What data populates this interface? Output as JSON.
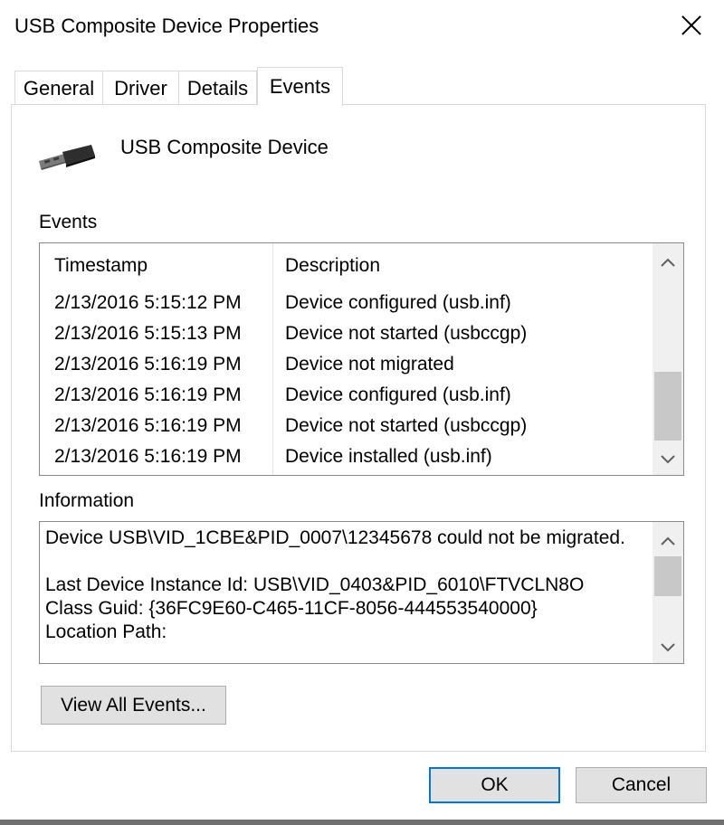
{
  "window": {
    "title": "USB Composite Device Properties"
  },
  "tabs": [
    {
      "label": "General"
    },
    {
      "label": "Driver"
    },
    {
      "label": "Details"
    },
    {
      "label": "Events"
    }
  ],
  "device": {
    "name": "USB Composite Device",
    "icon": "usb-plug-icon"
  },
  "events": {
    "label": "Events",
    "columns": {
      "timestamp": "Timestamp",
      "description": "Description"
    },
    "rows": [
      {
        "timestamp": "2/13/2016 5:15:12 PM",
        "description": "Device configured (usb.inf)"
      },
      {
        "timestamp": "2/13/2016 5:15:13 PM",
        "description": "Device not started (usbccgp)"
      },
      {
        "timestamp": "2/13/2016 5:16:19 PM",
        "description": "Device not migrated"
      },
      {
        "timestamp": "2/13/2016 5:16:19 PM",
        "description": "Device configured (usb.inf)"
      },
      {
        "timestamp": "2/13/2016 5:16:19 PM",
        "description": "Device not started (usbccgp)"
      },
      {
        "timestamp": "2/13/2016 5:16:19 PM",
        "description": "Device installed (usb.inf)"
      }
    ]
  },
  "information": {
    "label": "Information",
    "lines": [
      "Device USB\\VID_1CBE&PID_0007\\12345678 could not be migrated.",
      "",
      "Last Device Instance Id: USB\\VID_0403&PID_6010\\FTVCLN8O",
      "Class Guid: {36FC9E60-C465-11CF-8056-444553540000}",
      "Location Path:"
    ]
  },
  "buttons": {
    "view_all": "View All Events...",
    "ok": "OK",
    "cancel": "Cancel"
  }
}
